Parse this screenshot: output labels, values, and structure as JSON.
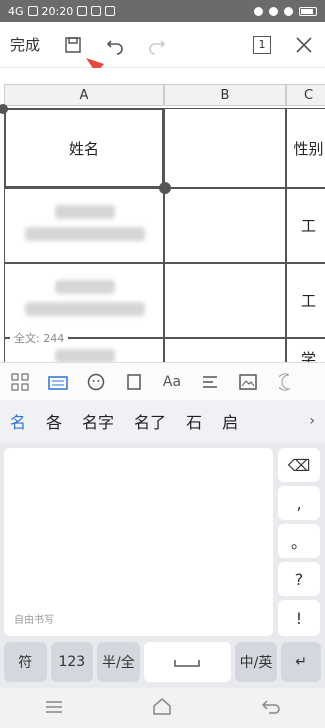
{
  "status_bar": {
    "signal": "4G",
    "time": "20:20",
    "battery": ""
  },
  "toolbar": {
    "done_label": "完成",
    "page_count": "1"
  },
  "sheet": {
    "columns": [
      "A",
      "B",
      "C"
    ],
    "header_row": {
      "a": "姓名",
      "c": "性别"
    },
    "rows": [
      {
        "c": "工"
      },
      {
        "c": "工"
      },
      {
        "c": "学"
      }
    ],
    "char_count": "全文: 244"
  },
  "format_bar": {
    "font_icon": "Aa"
  },
  "ime": {
    "candidates": [
      "名",
      "各",
      "名字",
      "名了",
      "石",
      "启"
    ],
    "more": "›",
    "handwrite_hint": "自由书写",
    "side_keys": [
      "⌫",
      ",",
      "。",
      "?",
      "!"
    ],
    "bottom_keys": {
      "symbol": "符",
      "num": "123",
      "half_full": "半/全",
      "lang": "中/英",
      "enter": "↵"
    }
  },
  "colors": {
    "accent": "#2f74d0",
    "arrow": "#e34a3d"
  }
}
